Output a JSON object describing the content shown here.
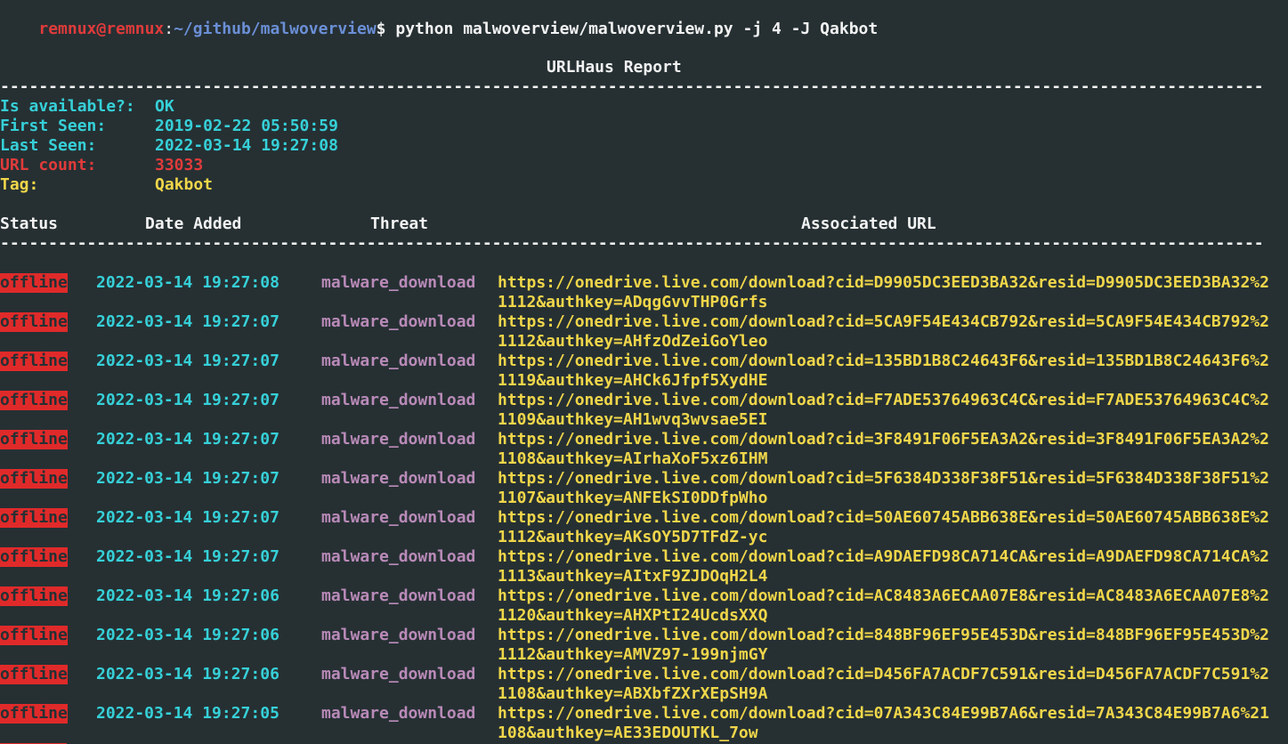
{
  "prompt": {
    "user_host": "remnux@remnux",
    "separator": ":",
    "path": "~/github/malwoverview",
    "symbol": "$",
    "command": " python malwoverview/malwoverview.py -j 4 -J Qakbot"
  },
  "report": {
    "title": "URLHaus Report",
    "separator_line": "-----------------------------------------------------------------------------------------------------------------------------------",
    "fields": [
      {
        "label": "Is available?:",
        "value": "OK"
      },
      {
        "label": "First Seen:",
        "value": "2019-02-22 05:50:59"
      },
      {
        "label": "Last Seen:",
        "value": "2022-03-14 19:27:08"
      },
      {
        "label": "URL count:",
        "value": "33033"
      },
      {
        "label": "Tag:",
        "value": "Qakbot"
      }
    ]
  },
  "table": {
    "headers": [
      "Status",
      "Date Added",
      "Threat",
      "Associated URL"
    ],
    "rows": [
      {
        "status": "offline",
        "date": "2022-03-14 19:27:08",
        "threat": "malware_download",
        "url1": "https://onedrive.live.com/download?cid=D9905DC3EED3BA32&resid=D9905DC3EED3BA32%2",
        "url2": "1112&authkey=ADqgGvvTHP0Grfs"
      },
      {
        "status": "offline",
        "date": "2022-03-14 19:27:07",
        "threat": "malware_download",
        "url1": "https://onedrive.live.com/download?cid=5CA9F54E434CB792&resid=5CA9F54E434CB792%2",
        "url2": "1112&authkey=AHfzOdZeiGoYleo"
      },
      {
        "status": "offline",
        "date": "2022-03-14 19:27:07",
        "threat": "malware_download",
        "url1": "https://onedrive.live.com/download?cid=135BD1B8C24643F6&resid=135BD1B8C24643F6%2",
        "url2": "1119&authkey=AHCk6Jfpf5XydHE"
      },
      {
        "status": "offline",
        "date": "2022-03-14 19:27:07",
        "threat": "malware_download",
        "url1": "https://onedrive.live.com/download?cid=F7ADE53764963C4C&resid=F7ADE53764963C4C%2",
        "url2": "1109&authkey=AH1wvq3wvsae5EI"
      },
      {
        "status": "offline",
        "date": "2022-03-14 19:27:07",
        "threat": "malware_download",
        "url1": "https://onedrive.live.com/download?cid=3F8491F06F5EA3A2&resid=3F8491F06F5EA3A2%2",
        "url2": "1108&authkey=AIrhaXoF5xz6IHM"
      },
      {
        "status": "offline",
        "date": "2022-03-14 19:27:07",
        "threat": "malware_download",
        "url1": "https://onedrive.live.com/download?cid=5F6384D338F38F51&resid=5F6384D338F38F51%2",
        "url2": "1107&authkey=ANFEkSI0DDfpWho"
      },
      {
        "status": "offline",
        "date": "2022-03-14 19:27:07",
        "threat": "malware_download",
        "url1": "https://onedrive.live.com/download?cid=50AE60745ABB638E&resid=50AE60745ABB638E%2",
        "url2": "1112&authkey=AKsOY5D7TFdZ-yc"
      },
      {
        "status": "offline",
        "date": "2022-03-14 19:27:07",
        "threat": "malware_download",
        "url1": "https://onedrive.live.com/download?cid=A9DAEFD98CA714CA&resid=A9DAEFD98CA714CA%2",
        "url2": "1113&authkey=AItxF9ZJDOqH2L4"
      },
      {
        "status": "offline",
        "date": "2022-03-14 19:27:06",
        "threat": "malware_download",
        "url1": "https://onedrive.live.com/download?cid=AC8483A6ECAA07E8&resid=AC8483A6ECAA07E8%2",
        "url2": "1120&authkey=AHXPtI24UcdsXXQ"
      },
      {
        "status": "offline",
        "date": "2022-03-14 19:27:06",
        "threat": "malware_download",
        "url1": "https://onedrive.live.com/download?cid=848BF96EF95E453D&resid=848BF96EF95E453D%2",
        "url2": "1112&authkey=AMVZ97-199njmGY"
      },
      {
        "status": "offline",
        "date": "2022-03-14 19:27:06",
        "threat": "malware_download",
        "url1": "https://onedrive.live.com/download?cid=D456FA7ACDF7C591&resid=D456FA7ACDF7C591%2",
        "url2": "1108&authkey=ABXbfZXrXEpSH9A"
      },
      {
        "status": "offline",
        "date": "2022-03-14 19:27:05",
        "threat": "malware_download",
        "url1": "https://onedrive.live.com/download?cid=07A343C84E99B7A6&resid=7A343C84E99B7A6%21",
        "url2": "108&authkey=AE33EDOUTKL_7ow"
      }
    ]
  },
  "colors": {
    "background": "#263033",
    "cyan": "#36d0d8",
    "red": "#e03b3b",
    "yellow": "#f0d64a",
    "magenta": "#b98ab8",
    "badge": "#e02a2a"
  }
}
